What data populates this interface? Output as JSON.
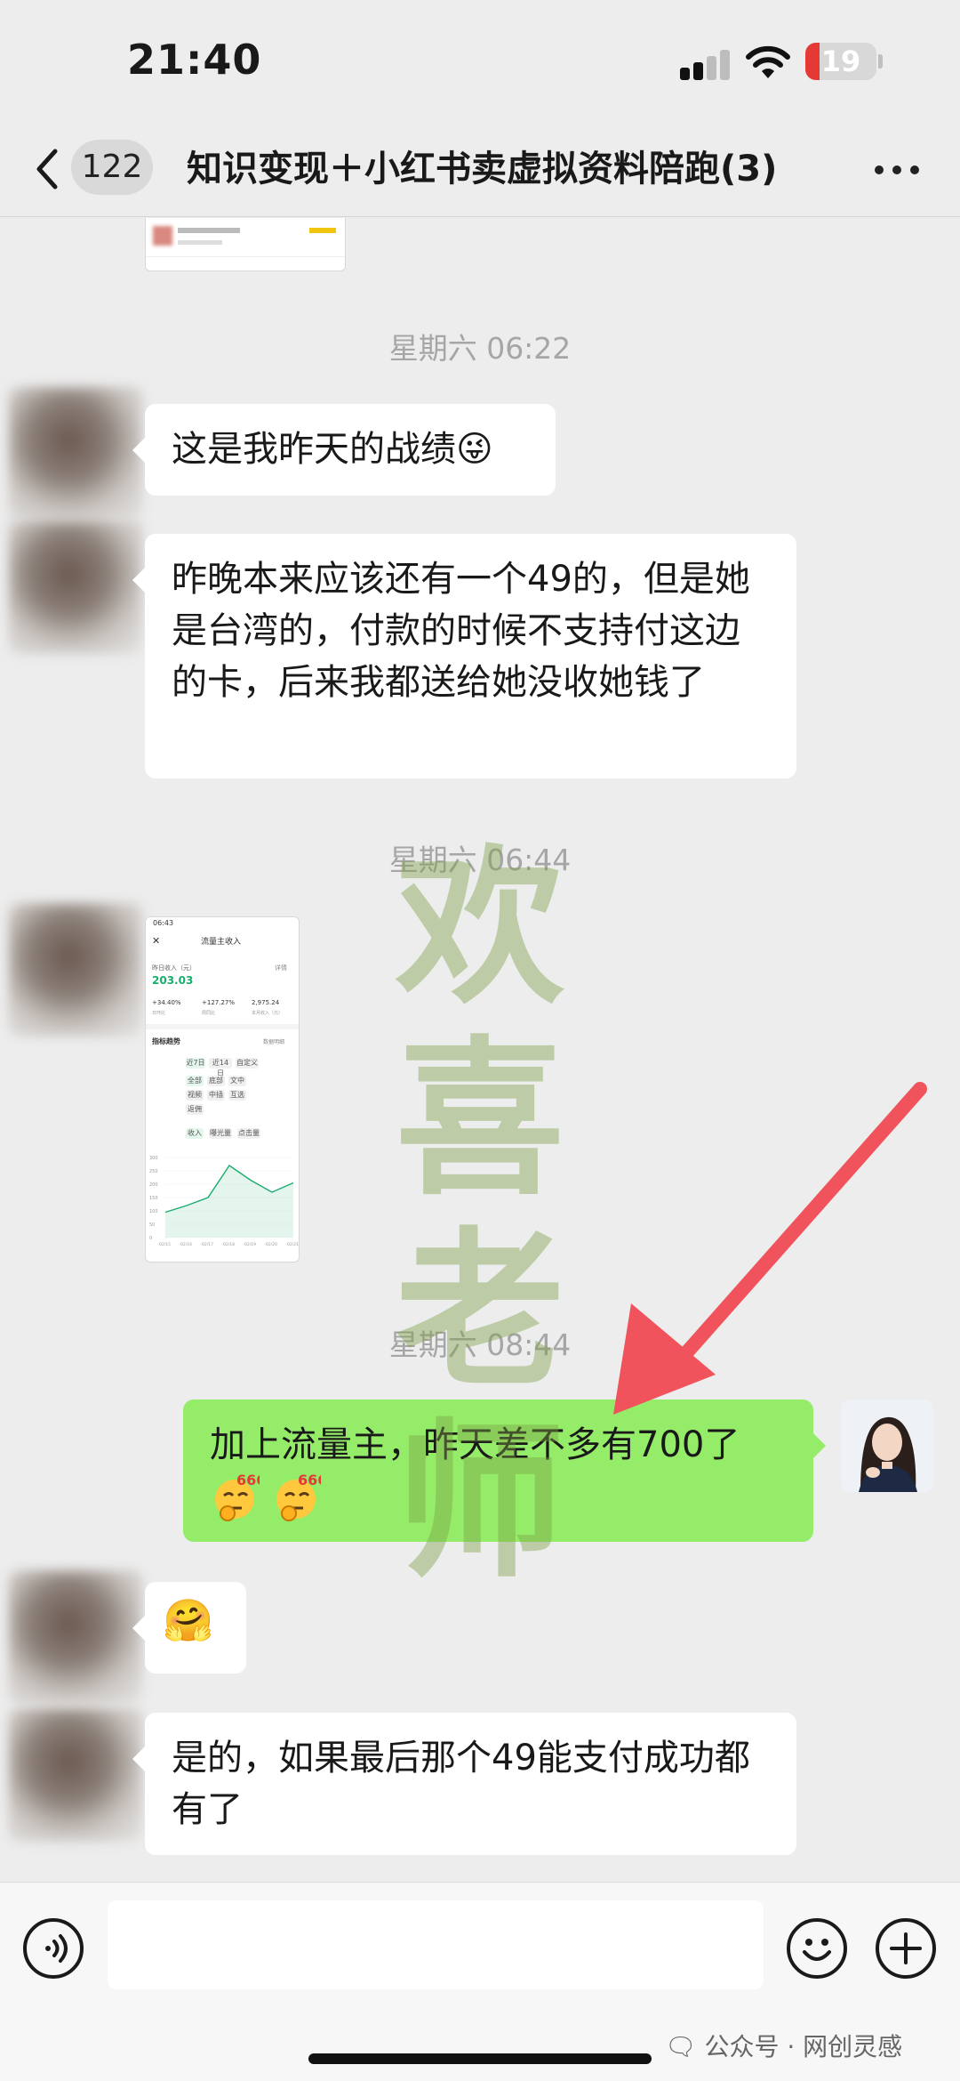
{
  "status_bar": {
    "time": "21:40",
    "battery": "19"
  },
  "nav": {
    "back_count": "122",
    "title": "知识变现＋小红书卖虚拟资料陪跑(3)"
  },
  "messages": [
    {
      "type": "time",
      "text": "星期六 06:22"
    },
    {
      "type": "left",
      "text": "这是我昨天的战绩😜"
    },
    {
      "type": "left",
      "text": "昨晚本来应该还有一个49的，但是她是台湾的，付款的时候不支持付这边的卡，后来我都送给她没收她钱了"
    },
    {
      "type": "time",
      "text": "星期六 06:44"
    },
    {
      "type": "time",
      "text": "星期六 08:44"
    },
    {
      "type": "right",
      "text": "加上流量主，昨天差不多有700了"
    },
    {
      "type": "left",
      "text": "🤗"
    },
    {
      "type": "left",
      "text": "是的，如果最后那个49能支付成功都有了"
    }
  ],
  "shared_screenshot": {
    "time": "06:43",
    "title": "流量主收入",
    "yesterday_label": "昨日收入（元）",
    "detail_link": "详情",
    "yesterday_value": "203.03",
    "stats": [
      {
        "value": "+34.40%",
        "label": "日环比"
      },
      {
        "value": "+127.27%",
        "label": "周同比"
      },
      {
        "value": "2,975.24",
        "label": "本月收入（元）"
      }
    ],
    "section_title": "指标趋势",
    "section_link": "数据明细",
    "filters_a": [
      "近7日",
      "近14日",
      "自定义"
    ],
    "ad_types": [
      "全部",
      "底部",
      "文中",
      "视频",
      "中插",
      "互选",
      "返佣"
    ],
    "metrics": [
      "收入",
      "曝光量",
      "点击量"
    ],
    "y_ticks": [
      "300",
      "250",
      "200",
      "150",
      "100",
      "50",
      "0"
    ],
    "x_ticks": [
      "02/15",
      "02/16",
      "02/17",
      "02/18",
      "02/19",
      "02/20",
      "02/21"
    ],
    "trend": [
      95,
      120,
      150,
      270,
      215,
      170,
      205
    ]
  },
  "watermark": {
    "chars": [
      "欢",
      "喜",
      "老",
      "师"
    ]
  },
  "input": {
    "placeholder": ""
  },
  "footer": {
    "mark": "🗨 公众号 · 网创灵感"
  },
  "colors": {
    "bubble_right": "#95ec69",
    "bubble_left": "#ffffff",
    "background": "#ededed",
    "arrow": "#f0535c"
  },
  "icons": {
    "back": "chevron-left-icon",
    "more": "more-dots-icon",
    "voice": "voice-icon",
    "emoji": "smile-icon",
    "plus": "plus-icon"
  }
}
